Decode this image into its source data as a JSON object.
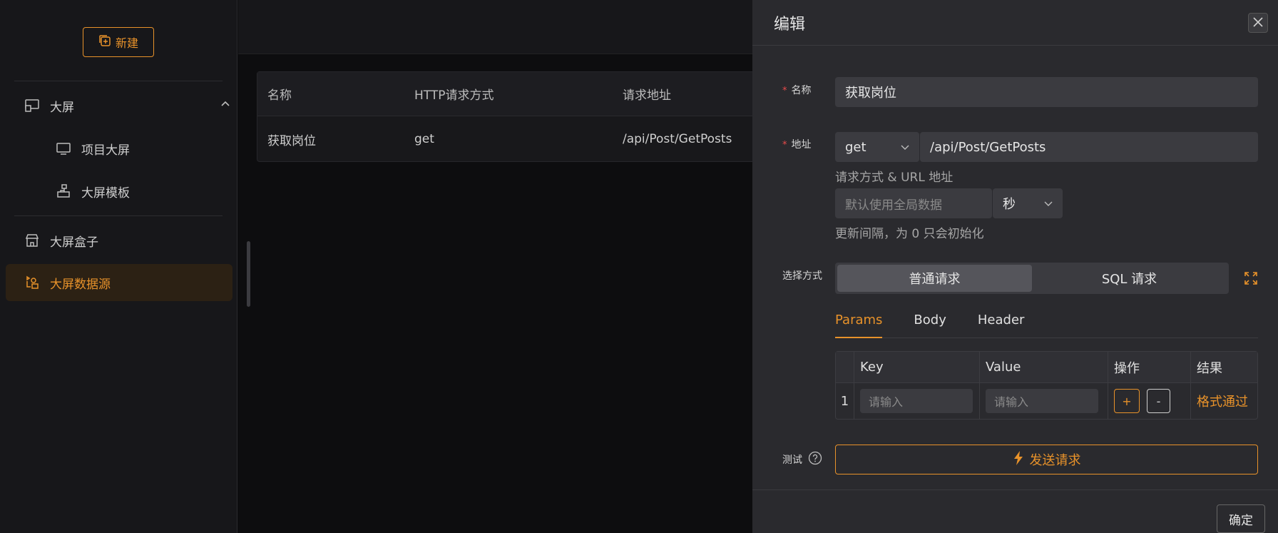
{
  "sidebar": {
    "new_label": "新建",
    "items": [
      {
        "label": "大屏"
      },
      {
        "label": "项目大屏"
      },
      {
        "label": "大屏模板"
      },
      {
        "label": "大屏盒子"
      },
      {
        "label": "大屏数据源"
      }
    ]
  },
  "table": {
    "headers": [
      "名称",
      "HTTP请求方式",
      "请求地址"
    ],
    "row": [
      "获取岗位",
      "get",
      "/api/Post/GetPosts"
    ]
  },
  "drawer": {
    "title": "编辑",
    "name_label": "名称",
    "name_value": "获取岗位",
    "addr_label": "地址",
    "method": "get",
    "url": "/api/Post/GetPosts",
    "method_hint": "请求方式 & URL 地址",
    "interval_placeholder": "默认使用全局数据",
    "interval_unit": "秒",
    "interval_hint": "更新间隔，为 0 只会初始化",
    "mode_label": "选择方式",
    "mode_options": [
      "普通请求",
      "SQL 请求"
    ],
    "tabs": [
      "Params",
      "Body",
      "Header"
    ],
    "params": {
      "headers": [
        "Key",
        "Value",
        "操作",
        "结果"
      ],
      "row_index": "1",
      "key_placeholder": "请输入",
      "value_placeholder": "请输入",
      "add": "+",
      "remove": "-",
      "result": "格式通过"
    },
    "test_label": "测试",
    "send_label": "发送请求",
    "ok_label": "确定"
  },
  "colors": {
    "accent": "#e8922a",
    "required": "#e84b4b"
  }
}
